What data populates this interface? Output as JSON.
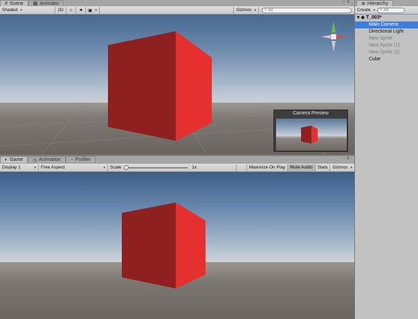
{
  "scene_tabs": [
    {
      "label": "Scene",
      "icon": "scene-icon"
    },
    {
      "label": "Animator",
      "icon": "animator-icon"
    }
  ],
  "scene_toolbar": {
    "shading": "Shaded",
    "mode_2d": "2D",
    "light_icon": "sun-icon",
    "audio_icon": "speaker-icon",
    "effects_icon": "image-icon",
    "gizmos": "Gizmos",
    "search_placeholder": "All"
  },
  "camera_preview": {
    "title": "Camera Preview"
  },
  "game_tabs": [
    {
      "label": "Game",
      "icon": "game-icon"
    },
    {
      "label": "Animation",
      "icon": "animation-icon"
    },
    {
      "label": "Profiler",
      "icon": "profiler-icon"
    }
  ],
  "game_toolbar": {
    "display": "Display 1",
    "aspect": "Free Aspect",
    "scale_label": "Scale",
    "scale_value": "1x",
    "scale_level": 0,
    "maximize": "Maximize On Play",
    "mute": "Mute Audio",
    "stats": "Stats",
    "gizmos": "Gizmos"
  },
  "hierarchy": {
    "tab_label": "Hierarchy",
    "create": "Create",
    "search_placeholder": "All",
    "scene_name": "T_003*",
    "items": [
      {
        "label": "Main Camera",
        "state": "selected"
      },
      {
        "label": "Directional Light",
        "state": "normal"
      },
      {
        "label": "New Sprite",
        "state": "inactive"
      },
      {
        "label": "New Sprite (1)",
        "state": "inactive"
      },
      {
        "label": "New Sprite (2)",
        "state": "inactive"
      },
      {
        "label": "Cube",
        "state": "normal"
      }
    ]
  },
  "colors": {
    "selection": "#3e7de0",
    "cube_front": "#8f2020",
    "cube_side": "#e63030",
    "cube_top": "#b82828"
  }
}
